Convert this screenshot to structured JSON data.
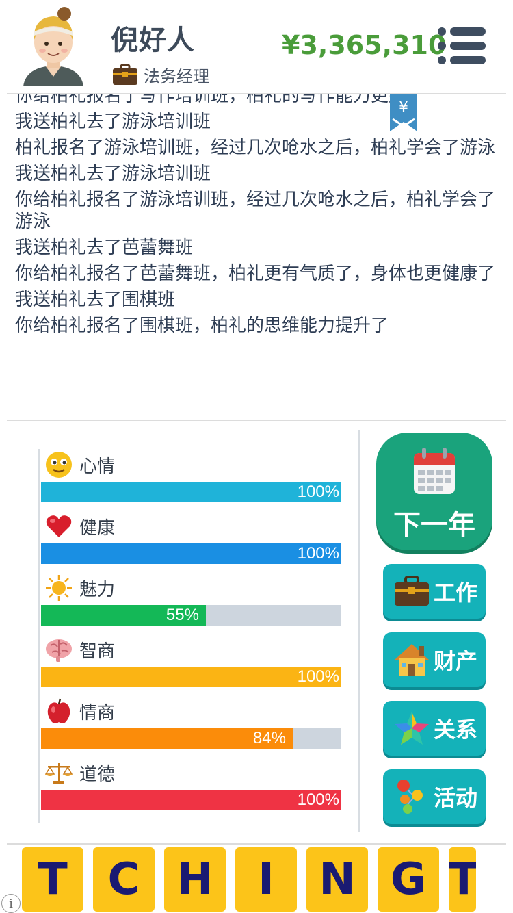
{
  "player": {
    "name": "倪好人",
    "job": "法务经理",
    "money": "¥3,365,310"
  },
  "ribbon": {
    "symbol": "¥"
  },
  "log": [
    "你给柏礼报名了写作培训班，柏礼的写作能力更好了",
    "我送柏礼去了游泳培训班",
    "柏礼报名了游泳培训班，经过几次呛水之后，柏礼学会了游泳",
    "我送柏礼去了游泳培训班",
    "你给柏礼报名了游泳培训班，经过几次呛水之后，柏礼学会了游泳",
    "我送柏礼去了芭蕾舞班",
    "你给柏礼报名了芭蕾舞班，柏礼更有气质了，身体也更健康了",
    "我送柏礼去了围棋班",
    "你给柏礼报名了围棋班，柏礼的思维能力提升了"
  ],
  "stats": [
    {
      "label": "心情",
      "value": 100,
      "pct": "100%",
      "color": "#1fb3d9",
      "icon": "smiley-icon"
    },
    {
      "label": "健康",
      "value": 100,
      "pct": "100%",
      "color": "#1a8fe3",
      "icon": "heart-icon"
    },
    {
      "label": "魅力",
      "value": 55,
      "pct": "55%",
      "color": "#14b857",
      "icon": "sun-icon"
    },
    {
      "label": "智商",
      "value": 100,
      "pct": "100%",
      "color": "#fbb414",
      "icon": "brain-icon"
    },
    {
      "label": "情商",
      "value": 84,
      "pct": "84%",
      "color": "#fb8c0a",
      "icon": "apple-icon"
    },
    {
      "label": "道德",
      "value": 100,
      "pct": "100%",
      "color": "#ef3344",
      "icon": "scales-icon"
    }
  ],
  "buttons": {
    "next_year": "下一年",
    "work": "工作",
    "property": "财产",
    "relations": "关系",
    "activities": "活动"
  },
  "ad": {
    "letters": [
      "T",
      "C",
      "H",
      "I",
      "N",
      "G",
      "T"
    ]
  },
  "colors": {
    "money": "#4a9c3a",
    "next_year": "#1aa37c",
    "side_button": "#14b2b9",
    "ad_tile": "#fcc419"
  }
}
